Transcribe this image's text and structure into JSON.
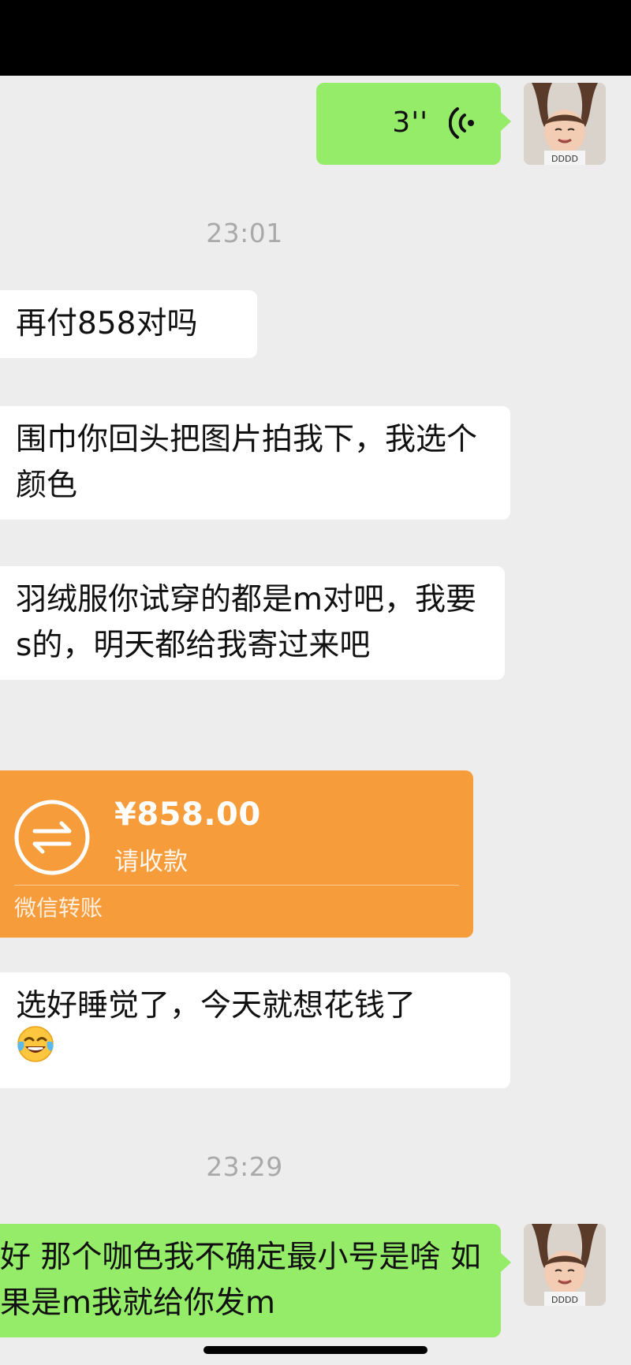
{
  "colors": {
    "background": "#ededed",
    "incoming_bubble": "#ffffff",
    "outgoing_bubble": "#95ec69",
    "transfer_card": "#f79c3a",
    "timestamp_text": "#a9a9a9"
  },
  "voice_message": {
    "duration": "3''",
    "icon": "voice-wave-icon"
  },
  "timestamps": [
    "23:01",
    "23:29"
  ],
  "incoming_messages": [
    {
      "text": "再付858对吗"
    },
    {
      "text": "围巾你回头把图片拍我下，我选个颜色"
    },
    {
      "text": "羽绒服你试穿的都是m对吧，我要s的，明天都给我寄过来吧"
    },
    {
      "text": "选好睡觉了，今天就想花钱了",
      "emoji": "face-with-tears-of-joy-emoji"
    }
  ],
  "transfer": {
    "amount": "¥858.00",
    "status": "请收款",
    "footer": "微信转账",
    "icon": "transfer-arrows-icon"
  },
  "outgoing_messages": [
    {
      "text": "好 那个咖色我不确定最小号是啥 如果是m我就给你发m"
    }
  ]
}
